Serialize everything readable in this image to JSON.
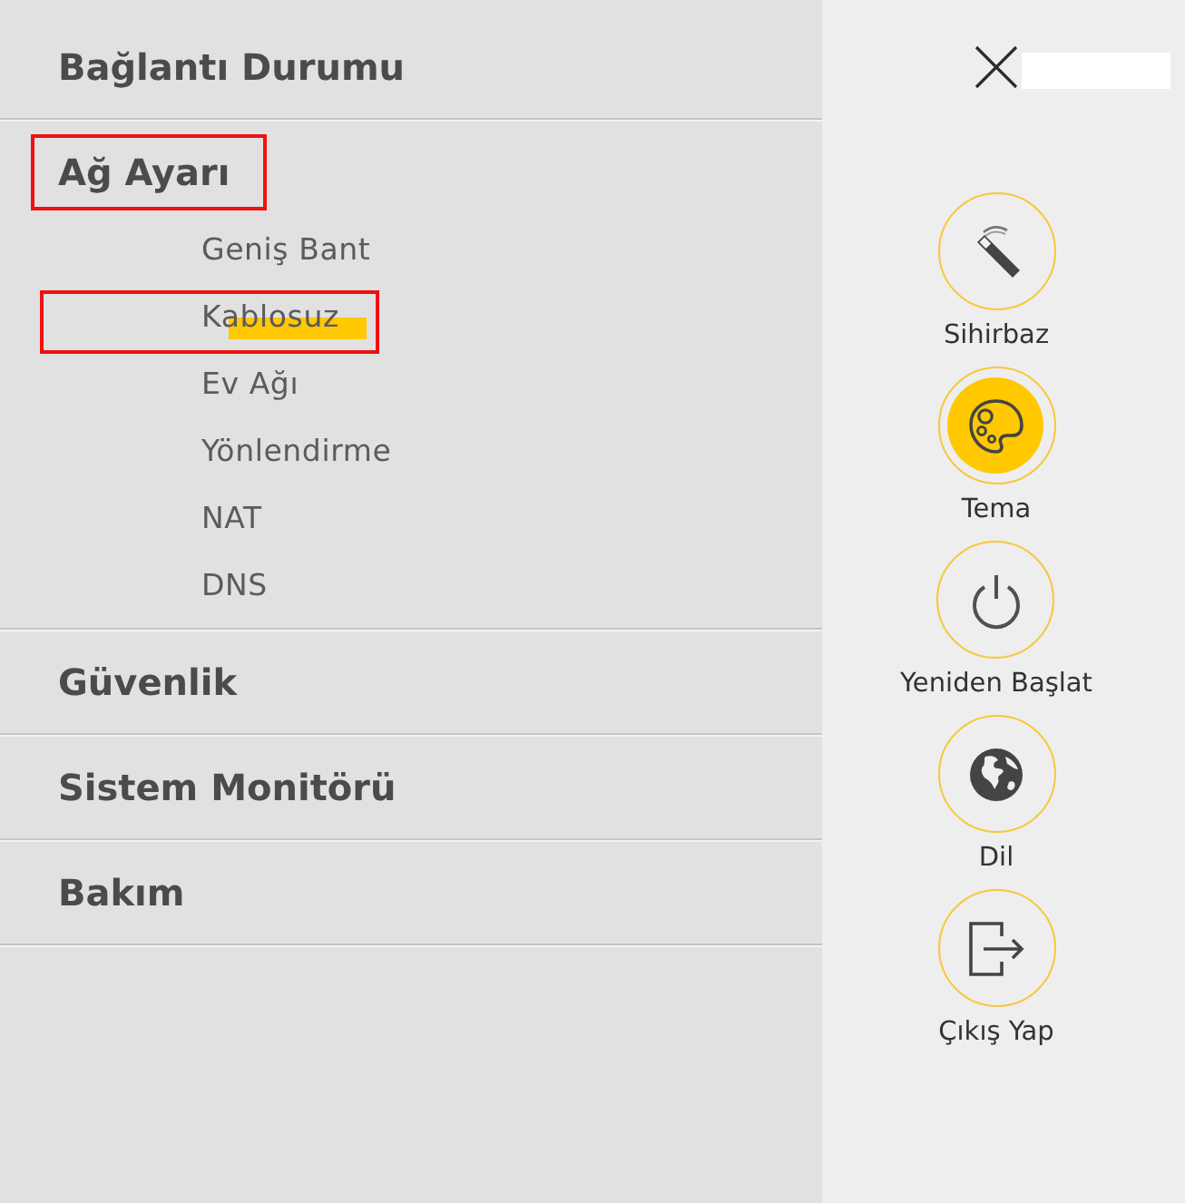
{
  "menu": [
    {
      "label": "Bağlantı Durumu",
      "expanded": false,
      "annotated": false
    },
    {
      "label": "Ağ Ayarı",
      "expanded": true,
      "annotated": true,
      "children": [
        {
          "label": "Geniş Bant",
          "annotated": false,
          "marked": false
        },
        {
          "label": "Kablosuz",
          "annotated": true,
          "marked": true
        },
        {
          "label": "Ev Ağı",
          "annotated": false,
          "marked": false
        },
        {
          "label": "Yönlendirme",
          "annotated": false,
          "marked": false
        },
        {
          "label": "NAT",
          "annotated": false,
          "marked": false
        },
        {
          "label": "DNS",
          "annotated": false,
          "marked": false
        }
      ]
    },
    {
      "label": "Güvenlik",
      "expanded": false,
      "annotated": false
    },
    {
      "label": "Sistem Monitörü",
      "expanded": false,
      "annotated": false
    },
    {
      "label": "Bakım",
      "expanded": false,
      "annotated": false
    }
  ],
  "actions": [
    {
      "label": "Sihirbaz",
      "kind": "wizard",
      "selected": false
    },
    {
      "label": "Tema",
      "kind": "theme",
      "selected": true
    },
    {
      "label": "Yeniden Başlat",
      "kind": "restart",
      "selected": false
    },
    {
      "label": "Dil",
      "kind": "language",
      "selected": false
    },
    {
      "label": "Çıkış Yap",
      "kind": "logout",
      "selected": false
    }
  ]
}
